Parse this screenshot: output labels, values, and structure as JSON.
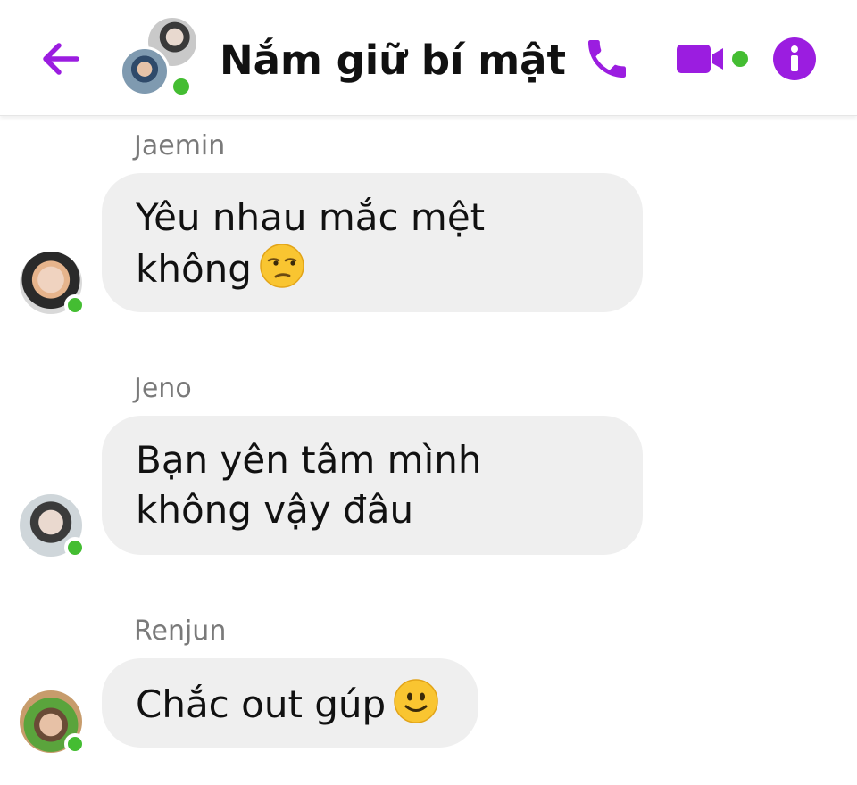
{
  "header": {
    "title": "Nắm giữ bí mật",
    "back_icon": "arrow-left-icon",
    "call_icon": "phone-icon",
    "video_icon": "video-camera-icon",
    "info_icon": "info-icon",
    "accent_color": "#9b1de0",
    "online_color": "#44bd32"
  },
  "messages": [
    {
      "sender": "Jaemin",
      "line1": "Yêu nhau mắc mệt",
      "line2": "không",
      "emoji": "unamused-face"
    },
    {
      "sender": "Jeno",
      "line1": "Bạn yên tâm mình",
      "line2": "không vậy đâu"
    },
    {
      "sender": "Renjun",
      "line1": "Chắc out gúp",
      "emoji": "slightly-smiling-face"
    }
  ]
}
